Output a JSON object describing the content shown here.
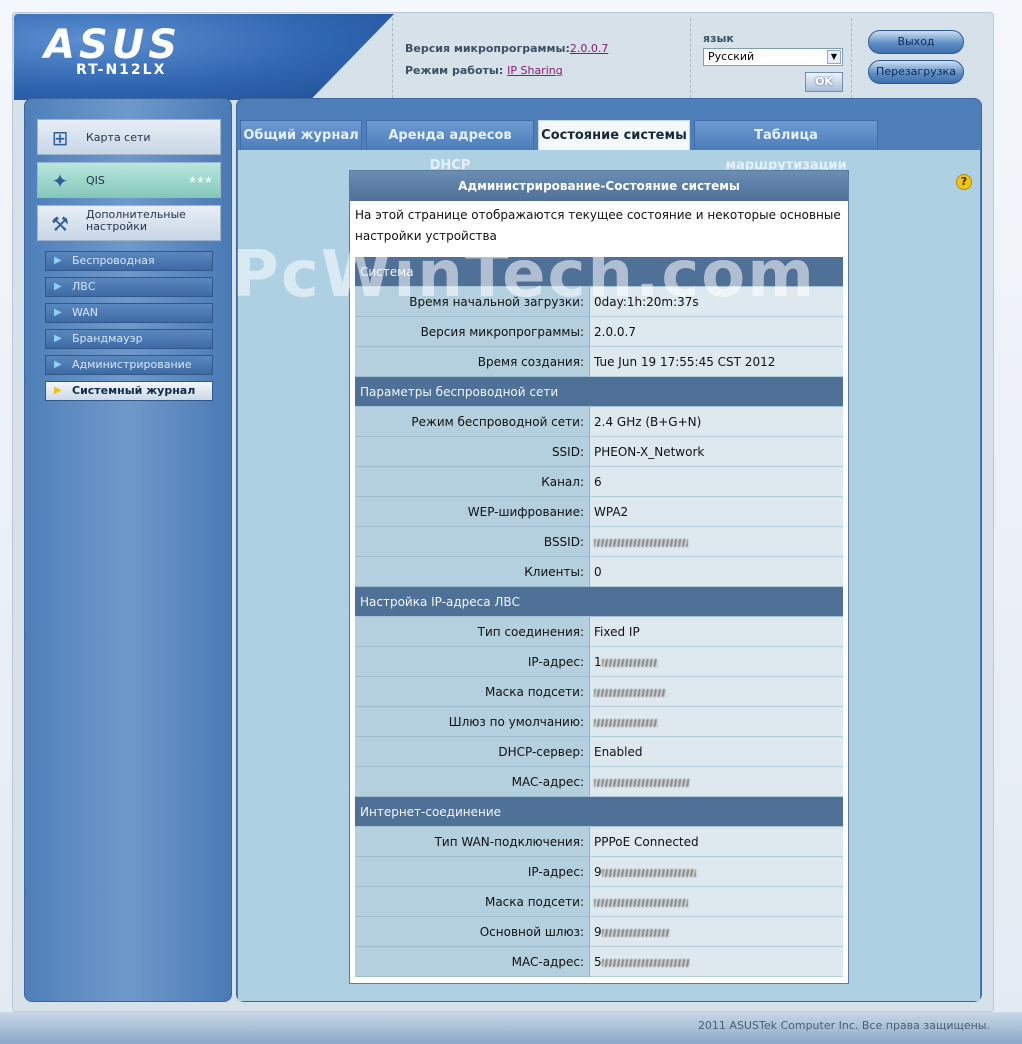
{
  "header": {
    "logo": "ASUS",
    "model": "RT-N12LX",
    "firmware_label": "Версия микропрограммы:",
    "firmware_value": "2.0.0.7",
    "mode_label": "Режим работы:",
    "mode_value": "IP Sharing",
    "language_label": "язык",
    "language_selected": "Русский",
    "ok_label": "OK",
    "logout_label": "Выход",
    "reboot_label": "Перезагрузка"
  },
  "nav": {
    "main": [
      {
        "label": "Карта сети",
        "icon": "network-map-icon"
      },
      {
        "label": "QIS",
        "icon": "wizard-wand-icon"
      },
      {
        "label": "Дополнительные настройки",
        "icon": "tools-icon"
      }
    ],
    "sub": [
      {
        "label": "Беспроводная"
      },
      {
        "label": "ЛВС"
      },
      {
        "label": "WAN"
      },
      {
        "label": "Брандмауэр"
      },
      {
        "label": "Администрирование"
      },
      {
        "label": "Системный журнал"
      }
    ]
  },
  "tabs": [
    {
      "label": "Общий журнал"
    },
    {
      "label": "Аренда адресов DHCP"
    },
    {
      "label": "Состояние системы"
    },
    {
      "label": "Таблица маршрутизации"
    }
  ],
  "panel": {
    "title": "Администрирование-Состояние системы",
    "description": "На этой странице отображаются текущее состояние и некоторые основные настройки устройства",
    "sections": {
      "system": "Система",
      "wireless": "Параметры беспроводной сети",
      "lan": "Настройка IP-адреса ЛВС",
      "internet": "Интернет-соединение"
    },
    "rows": {
      "boot_time": {
        "label": "Время начальной загрузки:",
        "value": "0day:1h:20m:37s"
      },
      "firmware": {
        "label": "Версия микропрограммы:",
        "value": "2.0.0.7"
      },
      "build_time": {
        "label": "Время создания:",
        "value": "Tue Jun 19 17:55:45 CST 2012"
      },
      "wireless_mode": {
        "label": "Режим беспроводной сети:",
        "value": "2.4 GHz (B+G+N)"
      },
      "ssid": {
        "label": "SSID:",
        "value": "PHEON-X_Network"
      },
      "channel": {
        "label": "Канал:",
        "value": "6"
      },
      "encryption": {
        "label": "WEP-шифрование:",
        "value": "WPA2"
      },
      "bssid": {
        "label": "BSSID:"
      },
      "clients": {
        "label": "Клиенты:",
        "value": "0"
      },
      "conn_type": {
        "label": "Тип соединения:",
        "value": "Fixed IP"
      },
      "lan_ip": {
        "label": "IP-адрес:",
        "value": "1"
      },
      "lan_mask": {
        "label": "Маска подсети:"
      },
      "gateway": {
        "label": "Шлюз по умолчанию:"
      },
      "dhcp": {
        "label": "DHCP-сервер:",
        "value": "Enabled"
      },
      "lan_mac": {
        "label": "MAC-адрес:"
      },
      "wan_type": {
        "label": "Тип WAN-подключения:",
        "value": "PPPoE Connected"
      },
      "wan_ip": {
        "label": "IP-адрес:",
        "value": "9"
      },
      "wan_mask": {
        "label": "Маска подсети:"
      },
      "wan_gateway": {
        "label": "Основной шлюз:",
        "value": "9"
      },
      "wan_mac": {
        "label": "MAC-адрес:",
        "value": "5"
      }
    }
  },
  "watermark": "PcWinTech.com",
  "footer": "2011 ASUSTek Computer Inc. Все права защищены."
}
